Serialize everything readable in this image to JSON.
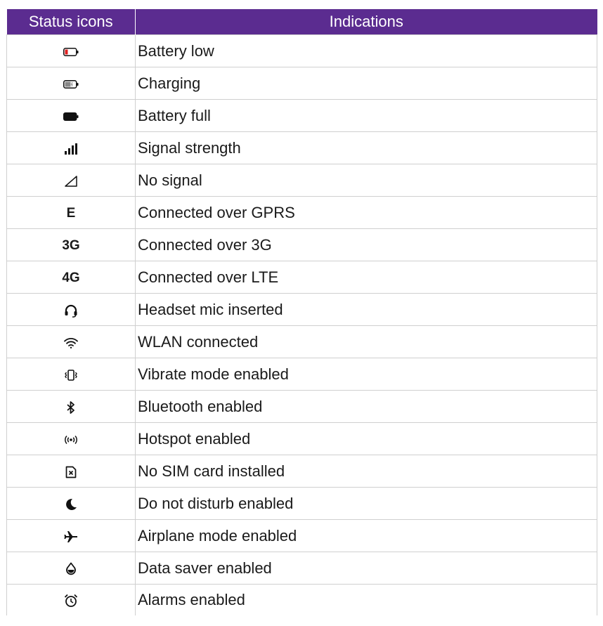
{
  "table": {
    "headers": {
      "icon_col": "Status icons",
      "label_col": "Indications"
    },
    "rows": [
      {
        "icon": "battery-low-icon",
        "label": "Battery low"
      },
      {
        "icon": "battery-charging-icon",
        "label": "Charging"
      },
      {
        "icon": "battery-full-icon",
        "label": "Battery full"
      },
      {
        "icon": "signal-strength-icon",
        "label": "Signal strength"
      },
      {
        "icon": "no-signal-icon",
        "label": "No signal"
      },
      {
        "icon": "gprs-icon",
        "icon_text": "E",
        "label": "Connected over GPRS"
      },
      {
        "icon": "3g-icon",
        "icon_text": "3G",
        "label": "Connected over 3G"
      },
      {
        "icon": "4g-icon",
        "icon_text": "4G",
        "label": "Connected over LTE"
      },
      {
        "icon": "headset-icon",
        "label": "Headset mic inserted"
      },
      {
        "icon": "wifi-icon",
        "label": "WLAN connected"
      },
      {
        "icon": "vibrate-icon",
        "label": "Vibrate mode enabled"
      },
      {
        "icon": "bluetooth-icon",
        "label": "Bluetooth enabled"
      },
      {
        "icon": "hotspot-icon",
        "label": "Hotspot enabled"
      },
      {
        "icon": "no-sim-icon",
        "label": "No SIM card installed"
      },
      {
        "icon": "moon-icon",
        "label": "Do not disturb enabled"
      },
      {
        "icon": "airplane-icon",
        "label": "Airplane mode enabled"
      },
      {
        "icon": "data-saver-icon",
        "label": "Data saver enabled"
      },
      {
        "icon": "alarm-icon",
        "label": "Alarms enabled"
      }
    ]
  },
  "colors": {
    "header_bg": "#5b2c90",
    "header_text": "#ffffff",
    "battery_low": "#e02020"
  }
}
